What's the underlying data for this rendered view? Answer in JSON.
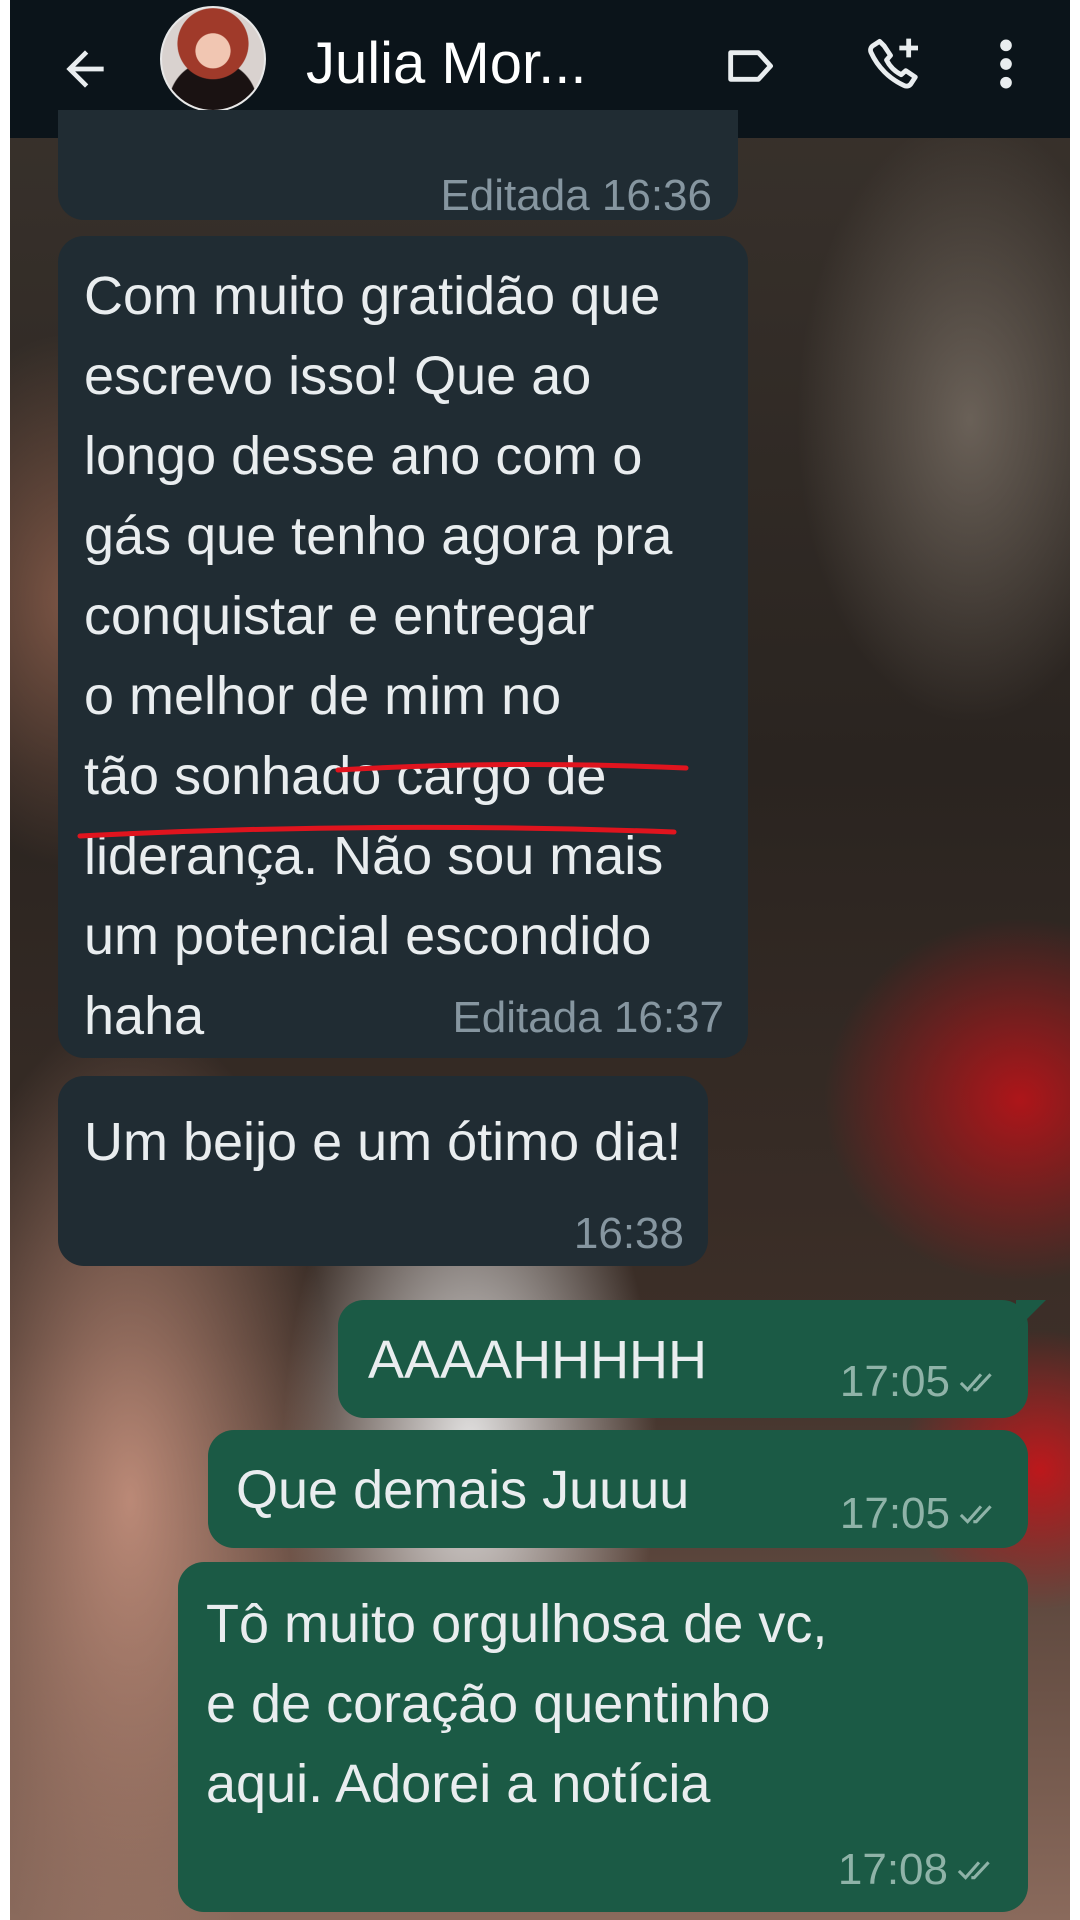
{
  "header": {
    "contact_name": "Julia Mor...",
    "icons": [
      "arrow-left-icon",
      "avatar",
      "label-icon",
      "add-call-icon",
      "more-vert-icon"
    ]
  },
  "messages": [
    {
      "id": "m0",
      "direction": "incoming",
      "status": "Editada 16:36"
    },
    {
      "id": "m1",
      "direction": "incoming",
      "lines": [
        "Com muito gratidão que",
        "escrevo isso! Que ao",
        "longo desse ano com o",
        "gás que tenho agora pra",
        "conquistar e entregar",
        "o melhor de mim no",
        "tão sonhado cargo de",
        "liderança. ",
        "Não sou mais",
        "um potencial escondido",
        "haha"
      ],
      "status": "Editada 16:37"
    },
    {
      "id": "m2",
      "direction": "incoming",
      "text": "Um beijo e um ótimo dia!",
      "time": "16:38"
    },
    {
      "id": "m3",
      "direction": "outgoing",
      "text": "AAAAHHHHH",
      "time": "17:05"
    },
    {
      "id": "m4",
      "direction": "outgoing",
      "text": "Que demais Juuuu",
      "time": "17:05"
    },
    {
      "id": "m5",
      "direction": "outgoing",
      "lines": [
        "Tô muito orgulhosa de vc,",
        "e de coração quentinho",
        "aqui. Adorei a notícia"
      ],
      "time": "17:08"
    }
  ],
  "colors": {
    "header_bg": "#0b141a",
    "incoming_bubble": "#202c33",
    "outgoing_bubble": "#1b5a45",
    "underline_annotation": "#e0141e"
  }
}
